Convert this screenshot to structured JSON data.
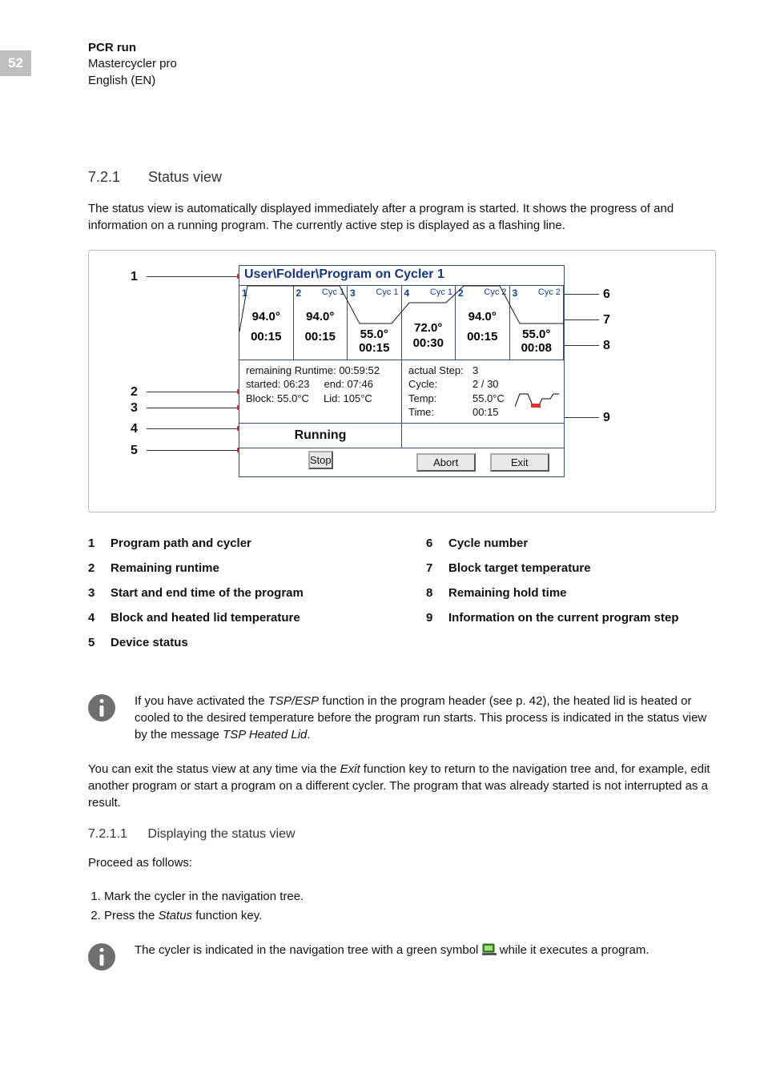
{
  "page_number": "52",
  "header": {
    "line1": "PCR run",
    "line2": "Mastercycler pro",
    "line3": "English (EN)"
  },
  "section": {
    "number": "7.2.1",
    "title": "Status view"
  },
  "intro": "The status view is automatically displayed immediately after a program is started. It shows the progress of and information on a running program. The currently active step is displayed as a flashing line.",
  "callouts": {
    "c1": "1",
    "c2": "2",
    "c3": "3",
    "c4": "4",
    "c5": "5",
    "c6": "6",
    "c7": "7",
    "c8": "8",
    "c9": "9"
  },
  "screen": {
    "title": "User\\Folder\\Program on Cycler 1",
    "steps": [
      {
        "idx": "1",
        "cyc": "",
        "temp": "94.0°",
        "time": "00:15"
      },
      {
        "idx": "2",
        "cyc": "Cyc 1",
        "temp": "94.0°",
        "time": "00:15"
      },
      {
        "idx": "3",
        "cyc": "Cyc 1",
        "temp": "55.0°",
        "time": "00:15"
      },
      {
        "idx": "4",
        "cyc": "Cyc 1",
        "temp": "72.0°",
        "time": "00:30"
      },
      {
        "idx": "2",
        "cyc": "Cyc 2",
        "temp": "94.0°",
        "time": "00:15"
      },
      {
        "idx": "3",
        "cyc": "Cyc 2",
        "temp": "55.0°",
        "time": "00:08"
      }
    ],
    "info_left": {
      "remaining": "remaining Runtime: 00:59:52",
      "started": "started: 06:23",
      "end": "end: 07:46",
      "block": "Block: 55.0°C",
      "lid": "Lid: 105°C"
    },
    "info_right": {
      "actual_step_k": "actual Step:",
      "actual_step_v": "3",
      "cycle_k": "Cycle:",
      "cycle_v": "2 / 30",
      "temp_k": "Temp:",
      "temp_v": "55.0°C",
      "time_k": "Time:",
      "time_v": "00:15"
    },
    "status_label": "Running",
    "buttons": {
      "stop": "Stop",
      "abort": "Abort",
      "exit": "Exit"
    }
  },
  "legend": {
    "l1": "Program path and cycler",
    "l2": "Remaining runtime",
    "l3": "Start and end time of the program",
    "l4": "Block and heated lid temperature",
    "l5": "Device status",
    "l6": "Cycle number",
    "l7": "Block target temperature",
    "l8": "Remaining hold time",
    "l9": "Information on the current program step"
  },
  "note1": {
    "pre": "If you have activated the ",
    "em1": "TSP/ESP",
    "mid": " function in the program header (see p. 42), the heated lid is heated or cooled to the desired temperature before the program run starts. This process is indicated in the status view by the message ",
    "em2": "TSP Heated Lid",
    "post": "."
  },
  "para2": {
    "pre": "You can exit the status view at any time via the ",
    "em": "Exit",
    "post": " function key to return to the navigation tree and, for example, edit another program or start a program on a different cycler. The program that was already started is not interrupted as a result."
  },
  "subsection": {
    "number": "7.2.1.1",
    "title": "Displaying the status view"
  },
  "proceed": "Proceed as follows:",
  "steps_list": {
    "s1": "Mark the cycler in the navigation tree.",
    "s2_pre": "Press the ",
    "s2_em": "Status",
    "s2_post": " function key."
  },
  "note2": {
    "pre": "The cycler is indicated in the navigation tree with a green symbol ",
    "post": " while it executes a program."
  }
}
